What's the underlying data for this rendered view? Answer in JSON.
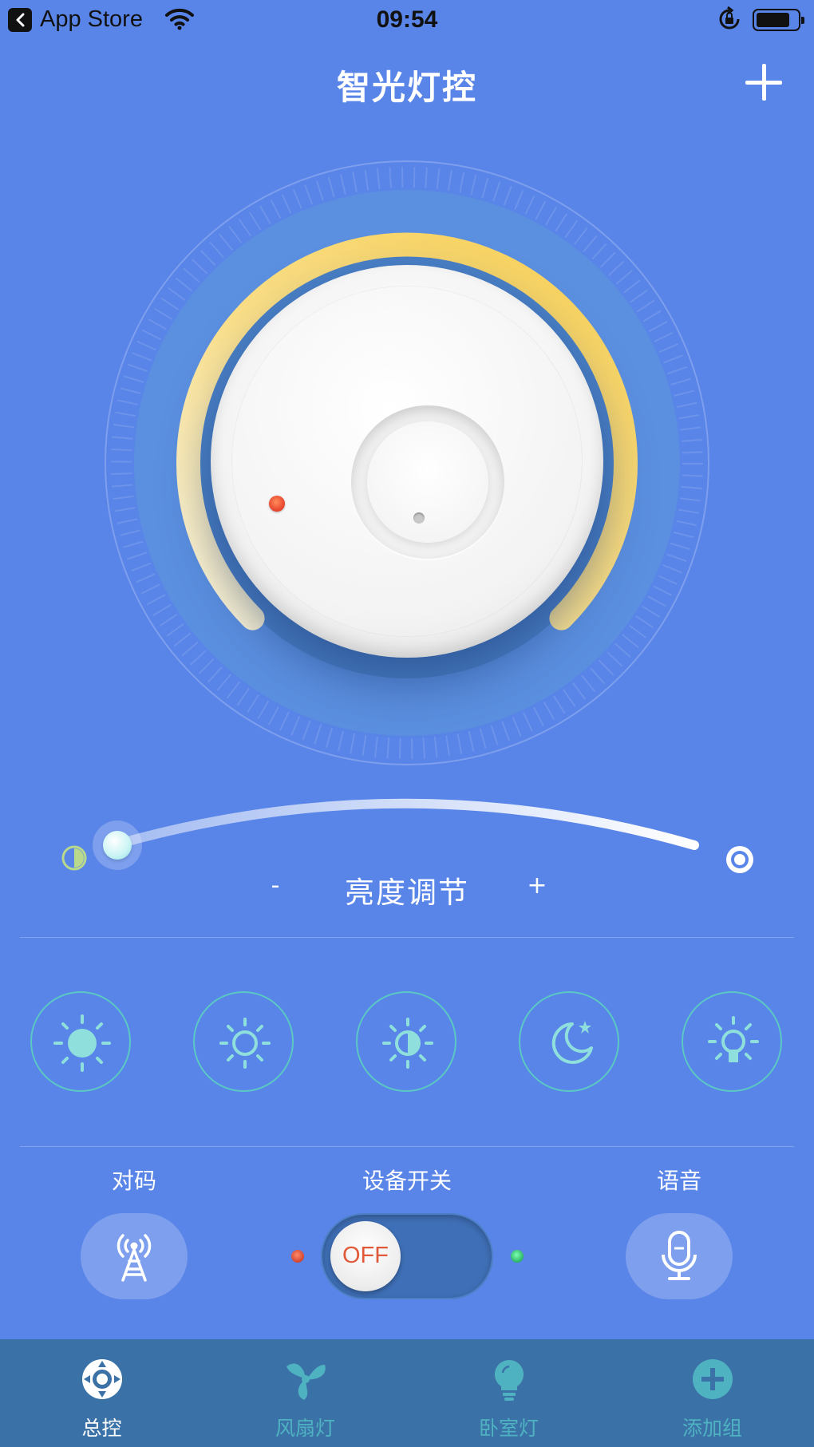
{
  "status_bar": {
    "back_app": "App Store",
    "time": "09:54",
    "battery_level": 0.78
  },
  "nav": {
    "title": "智光灯控",
    "add_icon": "plus-icon"
  },
  "dial": {
    "brightness_arc": "dial-arc",
    "knob": "rotary-knob"
  },
  "brightness": {
    "minus": "-",
    "label": "亮度调节",
    "plus": "+",
    "level": 0.0
  },
  "modes": [
    {
      "icon": "sun-full-icon"
    },
    {
      "icon": "sun-outline-icon"
    },
    {
      "icon": "sun-half-icon"
    },
    {
      "icon": "moon-star-icon"
    },
    {
      "icon": "bulb-icon"
    }
  ],
  "controls": {
    "pair_label": "对码",
    "switch_label": "设备开关",
    "voice_label": "语音",
    "switch_state": "OFF"
  },
  "colors": {
    "background": "#5985e8",
    "accent_teal": "#5bc8c4",
    "arc_yellow": "#f7cf55",
    "tabbar": "#3a72a8"
  },
  "tabs": [
    {
      "label": "总控",
      "icon": "control-icon",
      "active": true
    },
    {
      "label": "风扇灯",
      "icon": "fan-icon",
      "active": false
    },
    {
      "label": "卧室灯",
      "icon": "bulb-icon",
      "active": false
    },
    {
      "label": "添加组",
      "icon": "add-circle-icon",
      "active": false
    }
  ]
}
